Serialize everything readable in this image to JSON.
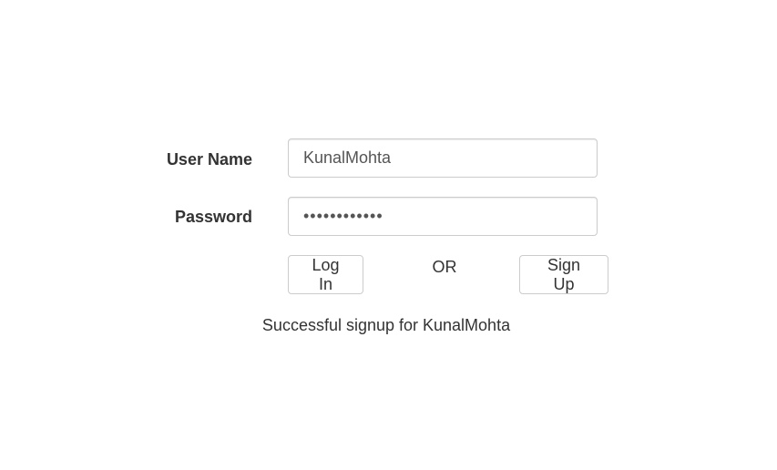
{
  "form": {
    "username_label": "User Name",
    "password_label": "Password",
    "username_value": "KunalMohta",
    "password_value": "************",
    "login_label": "Log In",
    "or_text": "OR",
    "signup_label": "Sign Up"
  },
  "status": {
    "message": "Successful signup for KunalMohta"
  }
}
